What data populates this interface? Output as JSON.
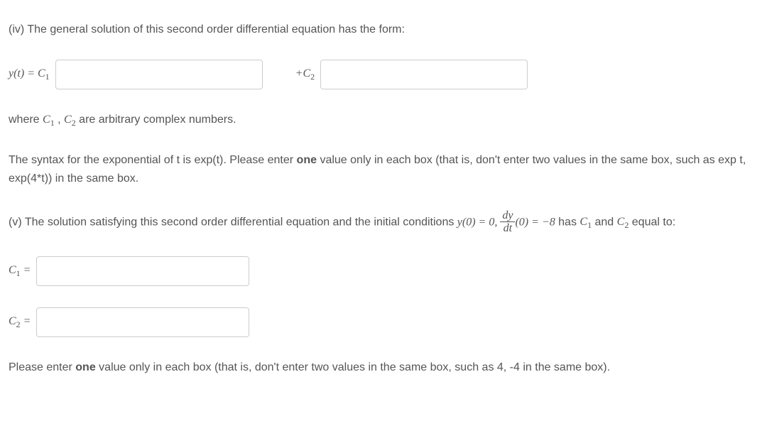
{
  "q4": {
    "prompt_pre": "(iv) The general solution of this second order differential equation has the form:",
    "eq_lhs": "y(t) = C",
    "eq_sub1": "1",
    "eq_plus": "+C",
    "eq_sub2": "2",
    "where_pre": "where ",
    "c1": "C",
    "c1sub": "1",
    "comma": " , ",
    "c2": "C",
    "c2sub": "2",
    "where_post": " are arbitrary complex numbers.",
    "syntax_pre": "The syntax for the exponential of t is exp(t). Please enter ",
    "syntax_bold": "one",
    "syntax_post": " value only in each box (that is, don't enter two values in the same box, such as exp t, exp(4*t)) in the same box."
  },
  "q5": {
    "prompt_pre": "(v) The solution satisfying this second order differential equation and the initial conditions ",
    "ic1": "y(0) = 0, ",
    "frac_num": "dy",
    "frac_den": "dt",
    "ic2": "(0) = −8",
    "prompt_mid": " has ",
    "c1": "C",
    "c1sub": "1",
    "and": " and ",
    "c2": "C",
    "c2sub": "2",
    "prompt_post": " equal to:",
    "row1_label": "C",
    "row1_sub": "1",
    "row1_eq": " =",
    "row2_label": "C",
    "row2_sub": "2",
    "row2_eq": " =",
    "note_pre": "Please enter ",
    "note_bold": "one",
    "note_post": " value only in each box (that is, don't enter two values in the same box, such as 4, -4 in the same box)."
  }
}
